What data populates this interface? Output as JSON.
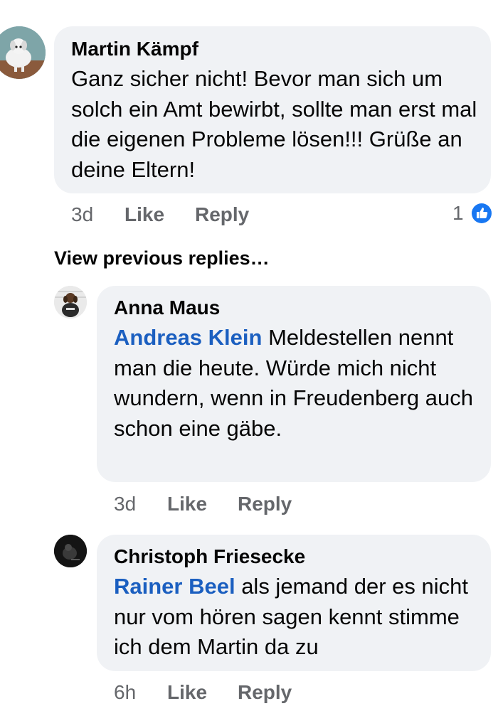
{
  "comments": [
    {
      "author": "Martin Kämpf",
      "text": "Ganz sicher nicht! Bevor man sich um solch ein Amt bewirbt, sollte man erst mal die eigenen Probleme lösen!!! Grüße an deine Eltern!",
      "time": "3d",
      "like_label": "Like",
      "reply_label": "Reply",
      "reaction_count": "1",
      "avatar_icon": "dog-avatar"
    }
  ],
  "view_previous_replies": "View previous replies…",
  "replies": [
    {
      "author": "Anna Maus",
      "mention": "Andreas Klein",
      "text": " Meldestellen nennt man die heute. Würde mich nicht wundern, wenn in Freudenberg auch schon eine gäbe.",
      "time": "3d",
      "like_label": "Like",
      "reply_label": "Reply",
      "avatar_icon": "dachshund-avatar"
    },
    {
      "author": "Christoph Friesecke",
      "mention": "Rainer Beel",
      "text": " als jemand der es nicht nur vom hören sagen kennt stimme ich dem Martin da zu",
      "time": "6h",
      "like_label": "Like",
      "reply_label": "Reply",
      "avatar_icon": "dark-avatar"
    }
  ],
  "colors": {
    "bubble": "#f0f2f5",
    "mention": "#1b5fc0",
    "meta": "#65676b",
    "like_reaction": "#1877f2"
  }
}
